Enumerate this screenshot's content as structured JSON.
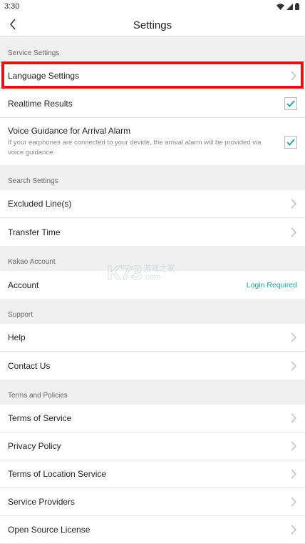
{
  "status_bar": {
    "time": "3:30",
    "icons": [
      "wifi-icon",
      "signal-icon",
      "battery-icon"
    ]
  },
  "header": {
    "title": "Settings",
    "back_icon": "chevron-left-icon"
  },
  "sections": {
    "service": {
      "header": "Service Settings",
      "language": "Language Settings",
      "realtime": "Realtime Results",
      "voice_title": "Voice Guidance for Arrival Alarm",
      "voice_desc": "If your earphones are connected to your devide, the arrival alarm will be provided via voice guidance."
    },
    "search": {
      "header": "Search Settings",
      "excluded": "Excluded Line(s)",
      "transfer": "Transfer Time"
    },
    "kakao": {
      "header": "Kakao Account",
      "account": "Account",
      "status": "Login Required"
    },
    "support": {
      "header": "Support",
      "help": "Help",
      "contact": "Contact Us"
    },
    "terms": {
      "header": "Terms and Policies",
      "tos": "Terms of Service",
      "privacy": "Privacy Policy",
      "location": "Terms of Location Service",
      "providers": "Service Providers",
      "opensource": "Open Source License"
    }
  },
  "checkbox_state": {
    "realtime": true,
    "voice_guidance": true
  },
  "colors": {
    "accent": "#1fa39a",
    "highlight": "#e2141b"
  },
  "watermark": {
    "main": "K73",
    "sub_line1": "游戏之家",
    "sub_line2": ".com"
  }
}
